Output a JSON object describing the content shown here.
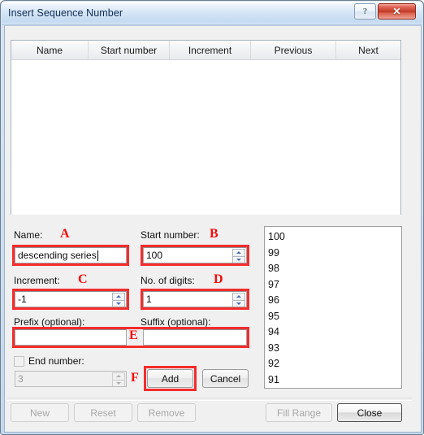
{
  "window": {
    "title": "Insert Sequence Number",
    "help_label": "?",
    "close_label": "✕"
  },
  "table": {
    "columns": [
      "Name",
      "Start number",
      "Increment",
      "Previous",
      "Next"
    ],
    "rows": []
  },
  "form": {
    "name_label": "Name:",
    "name_value": "descending series",
    "start_number_label": "Start number:",
    "start_number_value": "100",
    "increment_label": "Increment:",
    "increment_value": "-1",
    "digits_label": "No. of digits:",
    "digits_value": "1",
    "prefix_label": "Prefix (optional):",
    "prefix_value": "",
    "suffix_label": "Suffix (optional):",
    "suffix_value": "",
    "end_number_label": "End number:",
    "end_number_value": "3",
    "add_label": "Add",
    "cancel_label": "Cancel"
  },
  "annotations": {
    "a": "A",
    "b": "B",
    "c": "C",
    "d": "D",
    "e": "E",
    "f": "F",
    "color": "#f30c0c"
  },
  "preview": {
    "items": [
      "100",
      "99",
      "98",
      "97",
      "96",
      "95",
      "94",
      "93",
      "92",
      "91"
    ]
  },
  "footer": {
    "new_label": "New",
    "reset_label": "Reset",
    "remove_label": "Remove",
    "fill_range_label": "Fill Range",
    "close_label": "Close"
  }
}
